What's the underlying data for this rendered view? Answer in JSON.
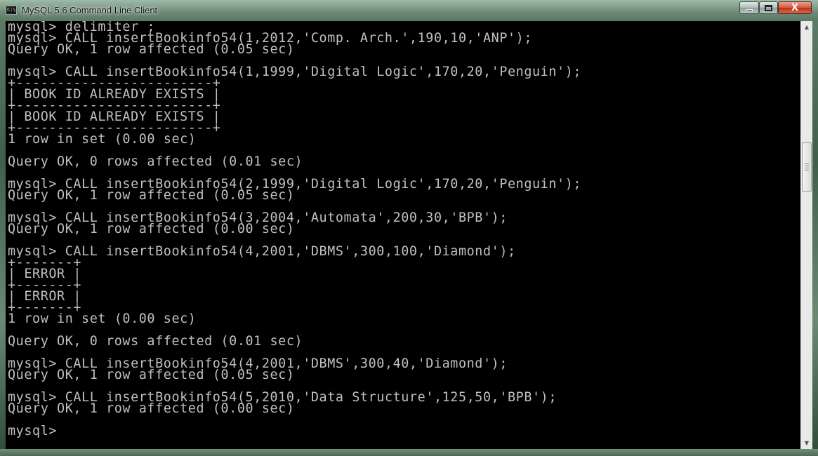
{
  "window": {
    "title": "MySQL 5.6 Command Line Client",
    "icon": "console-app-icon",
    "controls": {
      "minimize": "minimize-icon",
      "maximize": "maximize-icon",
      "close_label": "X"
    }
  },
  "console": {
    "lines": [
      "mysql> delimiter ;",
      "mysql> CALL insertBookinfo54(1,2012,'Comp. Arch.',190,10,'ANP');",
      "Query OK, 1 row affected (0.05 sec)",
      "",
      "mysql> CALL insertBookinfo54(1,1999,'Digital Logic',170,20,'Penguin');",
      "+------------------------+",
      "| BOOK ID ALREADY EXISTS |",
      "+------------------------+",
      "| BOOK ID ALREADY EXISTS |",
      "+------------------------+",
      "1 row in set (0.00 sec)",
      "",
      "Query OK, 0 rows affected (0.01 sec)",
      "",
      "mysql> CALL insertBookinfo54(2,1999,'Digital Logic',170,20,'Penguin');",
      "Query OK, 1 row affected (0.05 sec)",
      "",
      "mysql> CALL insertBookinfo54(3,2004,'Automata',200,30,'BPB');",
      "Query OK, 1 row affected (0.00 sec)",
      "",
      "mysql> CALL insertBookinfo54(4,2001,'DBMS',300,100,'Diamond');",
      "+-------+",
      "| ERROR |",
      "+-------+",
      "| ERROR |",
      "+-------+",
      "1 row in set (0.00 sec)",
      "",
      "Query OK, 0 rows affected (0.01 sec)",
      "",
      "mysql> CALL insertBookinfo54(4,2001,'DBMS',300,40,'Diamond');",
      "Query OK, 1 row affected (0.05 sec)",
      "",
      "mysql> CALL insertBookinfo54(5,2010,'Data Structure',125,50,'BPB');",
      "Query OK, 1 row affected (0.00 sec)",
      "",
      "mysql>"
    ]
  },
  "colors": {
    "console_bg": "#000000",
    "console_fg": "#c0c0c0"
  },
  "scrollbar": {
    "up_icon": "scroll-up-arrow-icon",
    "down_icon": "scroll-down-arrow-icon"
  }
}
